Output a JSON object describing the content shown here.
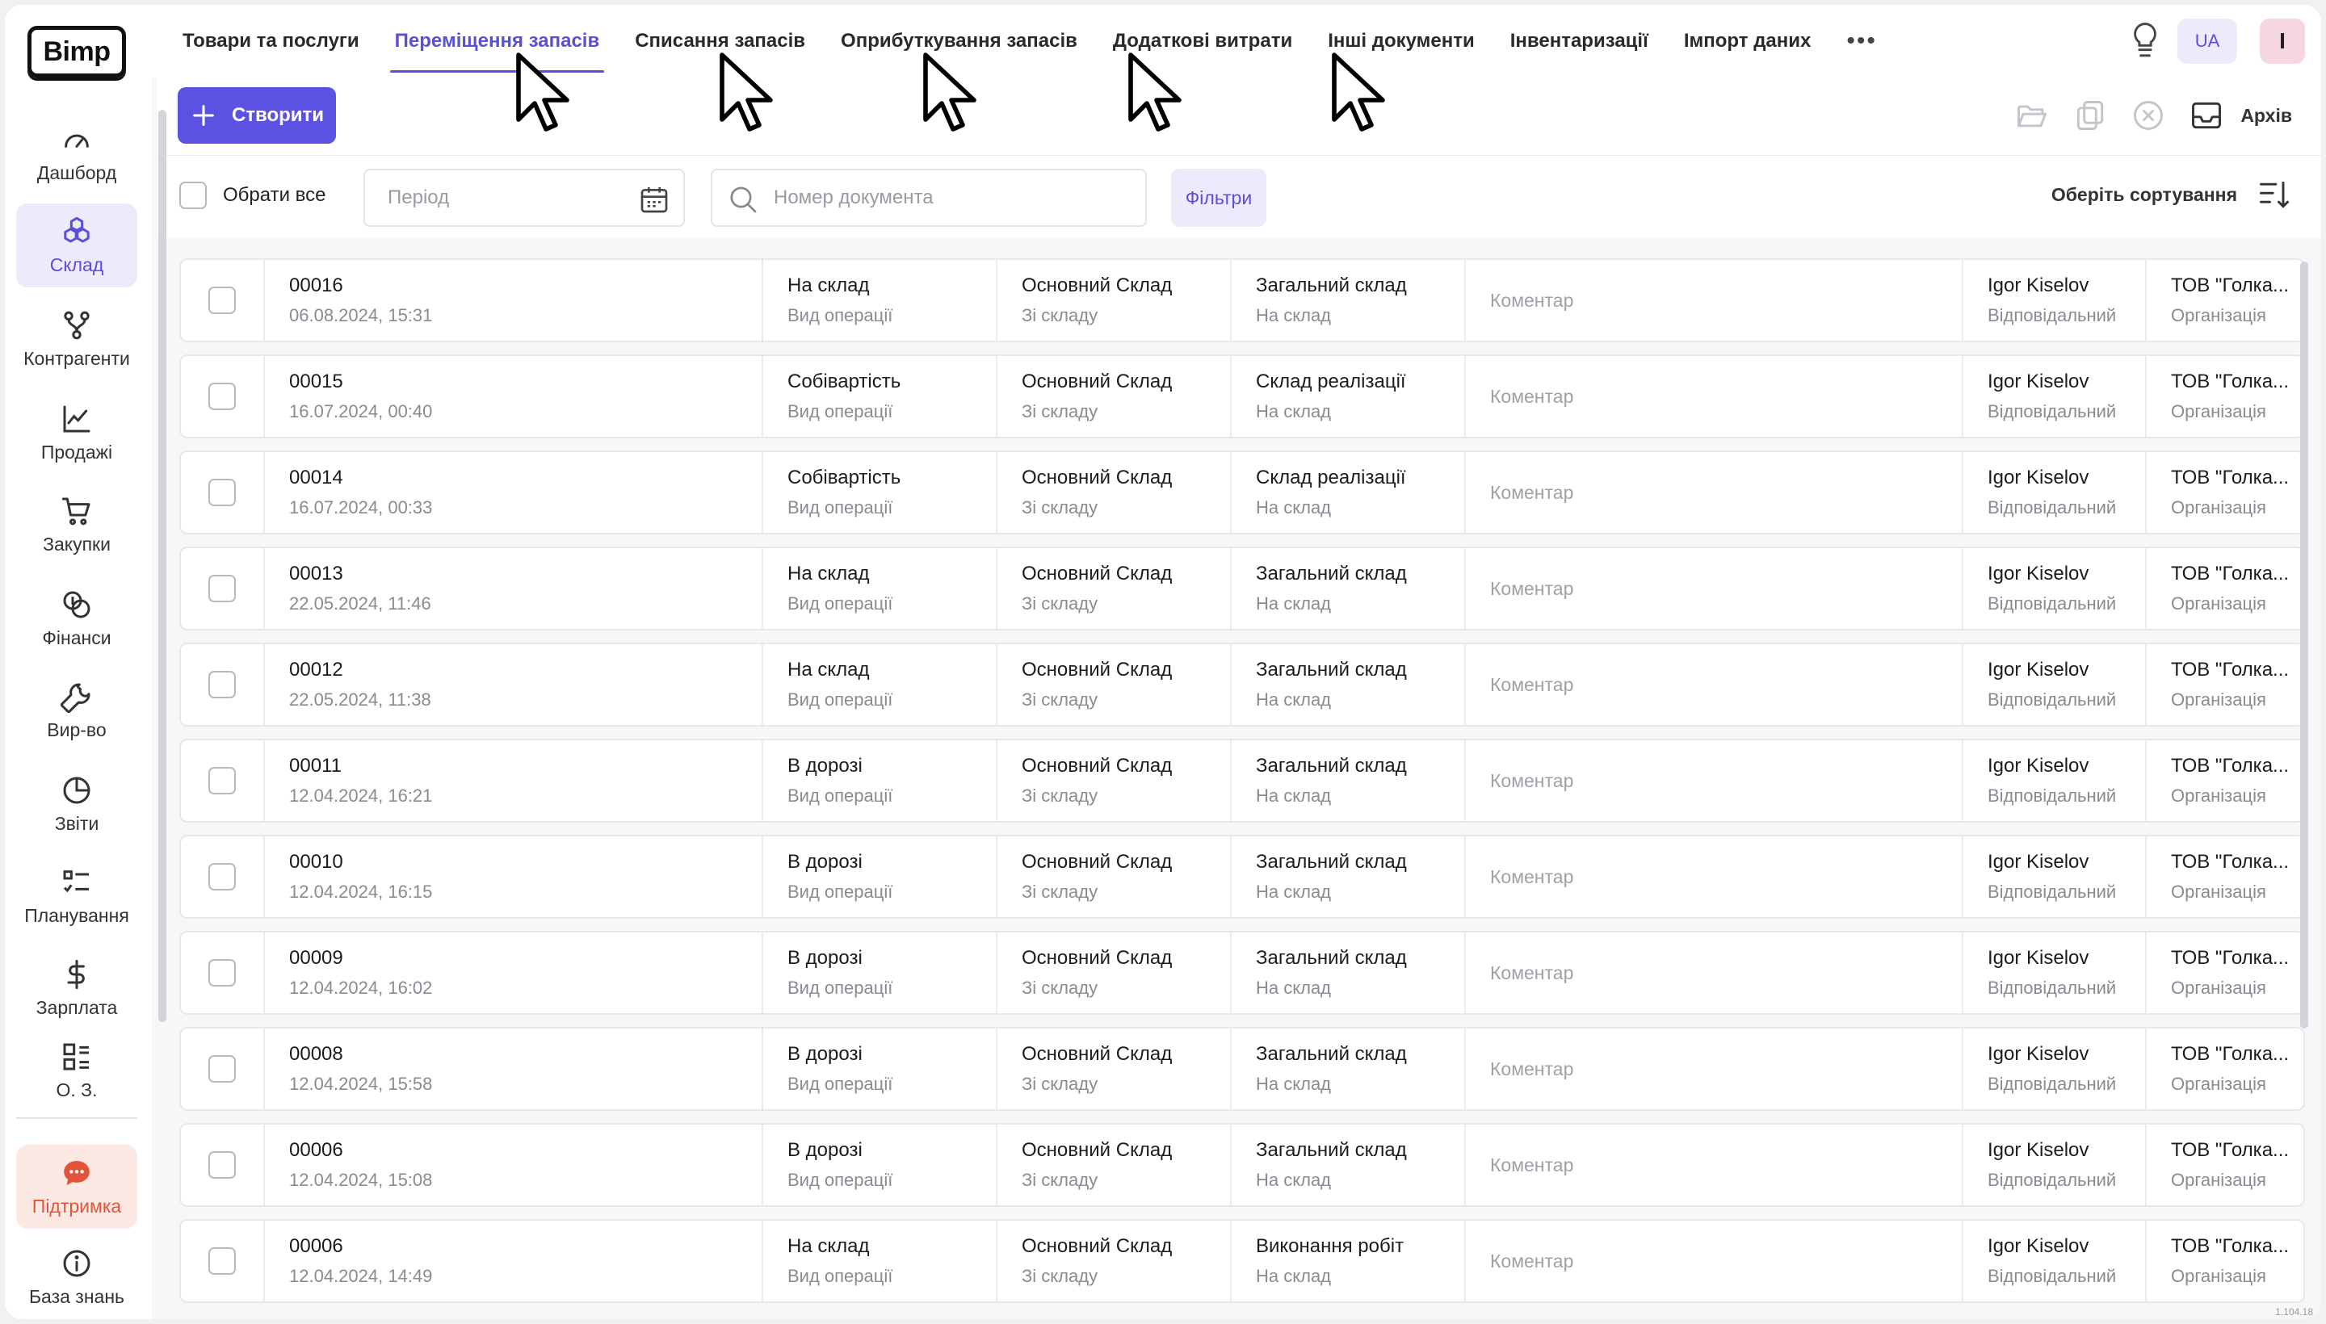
{
  "app": {
    "logo": "Bimp",
    "version": "1.104.18"
  },
  "sidebar": {
    "items": [
      {
        "label": "Дашборд",
        "icon": "gauge-icon"
      },
      {
        "label": "Склад",
        "icon": "boxes-icon",
        "active": true
      },
      {
        "label": "Контрагенти",
        "icon": "network-icon"
      },
      {
        "label": "Продажі",
        "icon": "line-chart-icon"
      },
      {
        "label": "Закупки",
        "icon": "cart-icon"
      },
      {
        "label": "Фінанси",
        "icon": "coins-icon"
      },
      {
        "label": "Вир-во",
        "icon": "wrench-icon"
      },
      {
        "label": "Звіти",
        "icon": "pie-chart-icon"
      },
      {
        "label": "Планування",
        "icon": "checklist-icon"
      },
      {
        "label": "Зарплата",
        "icon": "dollar-icon"
      },
      {
        "label": "О. З.",
        "icon": "grid-list-icon"
      }
    ],
    "support": "Підтримка",
    "knowledge_base": "База знань"
  },
  "topnav": {
    "tabs": [
      "Товари та послуги",
      "Переміщення запасів",
      "Списання запасів",
      "Оприбуткування запасів",
      "Додаткові витрати",
      "Інші документи",
      "Інвентаризації",
      "Імпорт даних"
    ],
    "active_tab": "Переміщення запасів",
    "more": "•••",
    "lang": "UA",
    "user_initial": "I"
  },
  "toolbar": {
    "create_label": "Створити",
    "archive_label": "Архів"
  },
  "filters": {
    "select_all": "Обрати все",
    "period_placeholder": "Період",
    "search_placeholder": "Номер документа",
    "filters_label": "Фільтри",
    "sort_label": "Оберіть сортування"
  },
  "labels": {
    "operation": "Вид операції",
    "from": "Зі складу",
    "to": "На склад",
    "comment": "Коментар",
    "responsible": "Відповідальний",
    "organization": "Організація"
  },
  "rows": [
    {
      "number": "00016",
      "date": "06.08.2024, 15:31",
      "operation": "На склад",
      "from": "Основний Склад",
      "to": "Загальний склад",
      "responsible": "Igor Kiselov",
      "organization": "ТОВ \"Голка..."
    },
    {
      "number": "00015",
      "date": "16.07.2024, 00:40",
      "operation": "Собівартість",
      "from": "Основний Склад",
      "to": "Склад реалізації",
      "responsible": "Igor Kiselov",
      "organization": "ТОВ \"Голка..."
    },
    {
      "number": "00014",
      "date": "16.07.2024, 00:33",
      "operation": "Собівартість",
      "from": "Основний Склад",
      "to": "Склад реалізації",
      "responsible": "Igor Kiselov",
      "organization": "ТОВ \"Голка..."
    },
    {
      "number": "00013",
      "date": "22.05.2024, 11:46",
      "operation": "На склад",
      "from": "Основний Склад",
      "to": "Загальний склад",
      "responsible": "Igor Kiselov",
      "organization": "ТОВ \"Голка..."
    },
    {
      "number": "00012",
      "date": "22.05.2024, 11:38",
      "operation": "На склад",
      "from": "Основний Склад",
      "to": "Загальний склад",
      "responsible": "Igor Kiselov",
      "organization": "ТОВ \"Голка..."
    },
    {
      "number": "00011",
      "date": "12.04.2024, 16:21",
      "operation": "В дорозі",
      "from": "Основний Склад",
      "to": "Загальний склад",
      "responsible": "Igor Kiselov",
      "organization": "ТОВ \"Голка..."
    },
    {
      "number": "00010",
      "date": "12.04.2024, 16:15",
      "operation": "В дорозі",
      "from": "Основний Склад",
      "to": "Загальний склад",
      "responsible": "Igor Kiselov",
      "organization": "ТОВ \"Голка..."
    },
    {
      "number": "00009",
      "date": "12.04.2024, 16:02",
      "operation": "В дорозі",
      "from": "Основний Склад",
      "to": "Загальний склад",
      "responsible": "Igor Kiselov",
      "organization": "ТОВ \"Голка..."
    },
    {
      "number": "00008",
      "date": "12.04.2024, 15:58",
      "operation": "В дорозі",
      "from": "Основний Склад",
      "to": "Загальний склад",
      "responsible": "Igor Kiselov",
      "organization": "ТОВ \"Голка..."
    },
    {
      "number": "00006",
      "date": "12.04.2024, 15:08",
      "operation": "В дорозі",
      "from": "Основний Склад",
      "to": "Загальний склад",
      "responsible": "Igor Kiselov",
      "organization": "ТОВ \"Голка..."
    },
    {
      "number": "00006",
      "date": "12.04.2024, 14:49",
      "operation": "На склад",
      "from": "Основний Склад",
      "to": "Виконання робіт",
      "responsible": "Igor Kiselov",
      "organization": "ТОВ \"Голка..."
    }
  ],
  "colors": {
    "accent": "#5b52e4",
    "accent_light": "#eeeafb",
    "support": "#e2553b"
  }
}
